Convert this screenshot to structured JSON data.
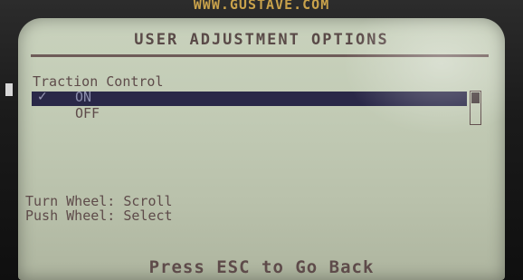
{
  "device": {
    "top_label": "WWW.GUSTAVE.COM"
  },
  "screen": {
    "title": "USER ADJUSTMENT OPTIONS",
    "section_label": "Traction Control",
    "options": [
      {
        "label": "ON",
        "selected": true,
        "checked": true
      },
      {
        "label": "OFF",
        "selected": false,
        "checked": false
      }
    ],
    "check_icon": "check-icon",
    "help": {
      "line1": "Turn Wheel: Scroll",
      "line2": "Push Wheel: Select"
    },
    "footer": "Press ESC to Go Back"
  },
  "colors": {
    "lcd_background": "#c2cbb5",
    "text": "#5e4b4a",
    "selection_bar": "#2a2848",
    "selection_text": "#8d8fae",
    "top_label": "#c9a24b"
  }
}
